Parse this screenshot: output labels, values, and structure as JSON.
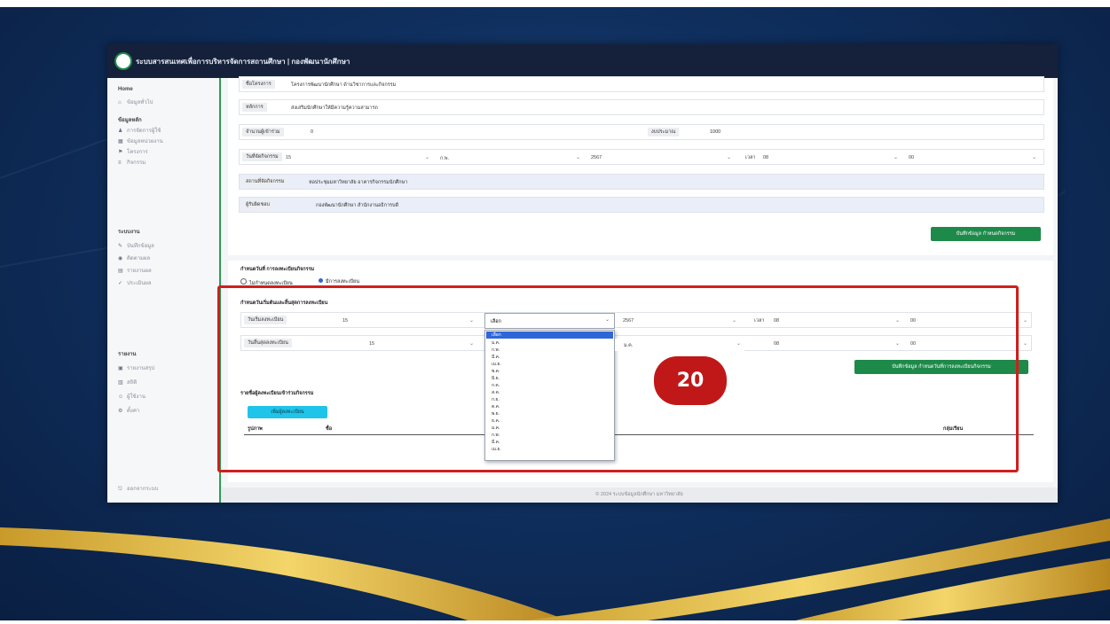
{
  "app": {
    "title": "ระบบสารสนเทศเพื่อการบริหารจัดการสถานศึกษา | กองพัฒนานักศึกษา"
  },
  "sidebar": {
    "sections": [
      {
        "header": "Home",
        "items": [
          {
            "label": "ข้อมูลทั่วไป"
          }
        ]
      },
      {
        "header": "ข้อมูลหลัก",
        "items": [
          {
            "label": "การจัดการผู้ใช้"
          },
          {
            "label": "ข้อมูลหน่วยงาน"
          },
          {
            "label": "โครงการ"
          },
          {
            "label": "กิจกรรม"
          }
        ]
      },
      {
        "header": "ระบบงาน",
        "items": [
          {
            "label": "บันทึกข้อมูล"
          },
          {
            "label": "ติดตามผล"
          },
          {
            "label": "รายงานผล"
          },
          {
            "label": "ประเมินผล"
          }
        ]
      },
      {
        "header": "รายงาน",
        "items": [
          {
            "label": "รายงานสรุป"
          },
          {
            "label": "สถิติ"
          },
          {
            "label": "ผู้ใช้งาน"
          },
          {
            "label": "ตั้งค่า"
          }
        ]
      }
    ],
    "bottom_label": "ออกจากระบบ"
  },
  "form": {
    "rows": [
      {
        "label": "ชื่อโครงการ",
        "value": "โครงการพัฒนานักศึกษา ด้านวิชาการและกิจกรรม"
      },
      {
        "label": "หลักการ",
        "value": "ส่งเสริมนักศึกษาให้มีความรู้ความสามารถ"
      },
      {
        "label": "จำนวนผู้เข้าร่วม",
        "value": "0",
        "label2": "งบประมาณ",
        "value2": "1000"
      },
      {
        "label": "วันที่จัดกิจกรรม",
        "sel1": "15",
        "sel2": "ก.พ.",
        "sel3": "2567",
        "sel4_label": "เวลา",
        "sel4": "08",
        "sel5": "00"
      },
      {
        "label": "สถานที่จัดกิจกรรม",
        "value": "หอประชุมมหาวิทยาลัย อาคารกิจกรรมนักศึกษา"
      },
      {
        "label": "ผู้รับผิดชอบ",
        "value": "กองพัฒนานักศึกษา สำนักงานอธิการบดี"
      }
    ],
    "save_button": "บันทึกข้อมูล กำหนดกิจกรรม"
  },
  "section2": {
    "title": "กำหนดวันที่ การลงทะเบียนกิจกรรม",
    "radio1": "ไม่กำหนดลงทะเบียน",
    "radio2": "มีการลงทะเบียน",
    "sub_title": "กำหนดวันเริ่มต้นและสิ้นสุดการลงทะเบียน",
    "start_label": "วันเริ่มลงทะเบียน",
    "start_day": "15",
    "start_month_selected": "เลือก",
    "start_year": "2567",
    "time_label": "เวลา",
    "start_hour": "08",
    "start_min": "00",
    "end_label": "วันสิ้นสุดลงทะเบียน",
    "end_day": "15",
    "end_year": "2567",
    "end_hour": "08",
    "end_min": "00",
    "save_button": "บันทึกข้อมูล กำหนดวันที่การลงทะเบียนกิจกรรม",
    "list_title": "รายชื่อผู้ลงทะเบียนเข้าร่วมกิจกรรม",
    "add_button": "เพิ่มผู้ลงทะเบียน",
    "table_headers": [
      "รูปภาพ",
      "ชื่อ",
      "กลุ่มเรียน"
    ]
  },
  "dropdown": {
    "options": [
      "เลือก",
      "ม.ค.",
      "ก.พ.",
      "มี.ค.",
      "เม.ย.",
      "พ.ค.",
      "มิ.ย.",
      "ก.ค.",
      "ส.ค.",
      "ก.ย.",
      "ต.ค.",
      "พ.ย.",
      "ธ.ค.",
      "ม.ค.",
      "ก.พ.",
      "มี.ค.",
      "เม.ย."
    ]
  },
  "badge": "20",
  "footer": "© 2024 ระบบข้อมูลนักศึกษา มหาวิทยาลัย",
  "colors": {
    "green": "#1e8a4a",
    "highlight": "#cf1f1f",
    "topbar": "#15213b",
    "cyan": "#20c4e8",
    "select_blue": "#2f66d8"
  }
}
